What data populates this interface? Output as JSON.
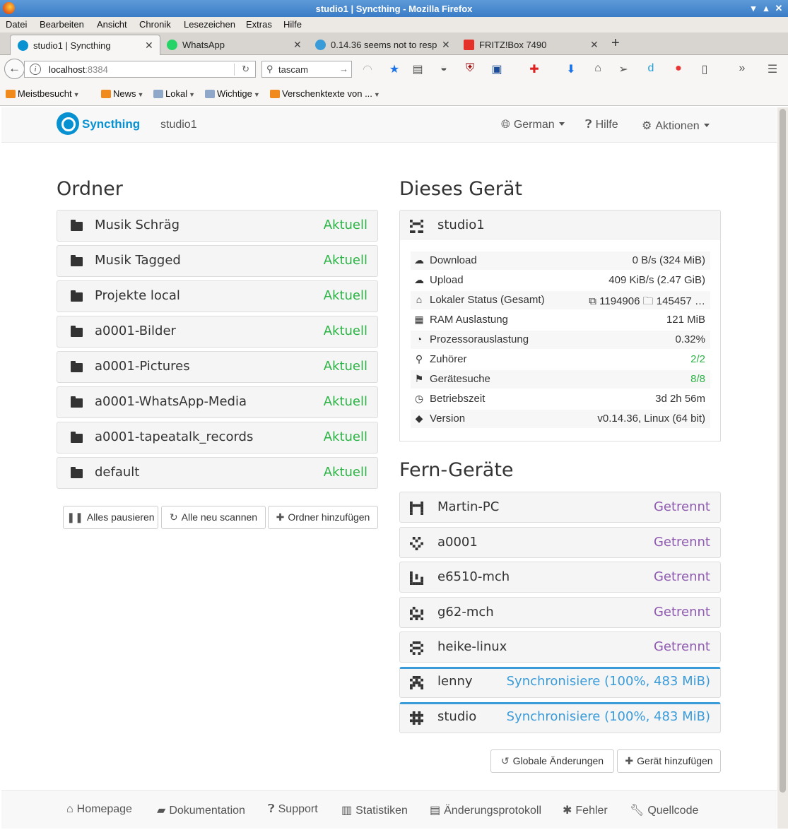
{
  "window": {
    "title": "studio1 | Syncthing - Mozilla Firefox"
  },
  "menu": [
    "Datei",
    "Bearbeiten",
    "Ansicht",
    "Chronik",
    "Lesezeichen",
    "Extras",
    "Hilfe"
  ],
  "tabs": [
    {
      "label": "studio1 | Syncthing"
    },
    {
      "label": "WhatsApp"
    },
    {
      "label": "0.14.36 seems not to resp"
    },
    {
      "label": "FRITZ!Box 7490"
    }
  ],
  "urlbar": {
    "host": "localhost",
    "port": ":8384"
  },
  "search": {
    "value": "tascam"
  },
  "bookmarks": [
    "Meistbesucht",
    "News",
    "Lokal",
    "Wichtige",
    "Verschenktexte von ..."
  ],
  "app": {
    "brand": "Syncthing",
    "device": "studio1",
    "nav": {
      "language": "German",
      "help": "Hilfe",
      "actions": "Aktionen"
    }
  },
  "folders": {
    "heading": "Ordner",
    "items": [
      {
        "name": "Musik Schräg",
        "status": "Aktuell"
      },
      {
        "name": "Musik Tagged",
        "status": "Aktuell"
      },
      {
        "name": "Projekte local",
        "status": "Aktuell"
      },
      {
        "name": "a0001-Bilder",
        "status": "Aktuell"
      },
      {
        "name": "a0001-Pictures",
        "status": "Aktuell"
      },
      {
        "name": "a0001-WhatsApp-Media",
        "status": "Aktuell"
      },
      {
        "name": "a0001-tapeatalk_records",
        "status": "Aktuell"
      },
      {
        "name": "default",
        "status": "Aktuell"
      }
    ],
    "buttons": {
      "pause": "Alles pausieren",
      "rescan": "Alle neu scannen",
      "add": "Ordner hinzufügen"
    }
  },
  "this_device": {
    "heading": "Dieses Gerät",
    "name": "studio1",
    "rows": [
      {
        "label": "Download",
        "value": "0 B/s (324 MiB)",
        "icon": "cloud-download-icon",
        "color": "#333333"
      },
      {
        "label": "Upload",
        "value": "409 KiB/s (2.47 GiB)",
        "icon": "cloud-upload-icon",
        "color": "#333333"
      },
      {
        "label": "Lokaler Status (Gesamt)",
        "value": "⧉ 1194906   🗀 145457   …",
        "icon": "home-icon",
        "color": "#333333"
      },
      {
        "label": "RAM Auslastung",
        "value": "121 MiB",
        "icon": "ram-icon",
        "color": "#333333"
      },
      {
        "label": "Prozessorauslastung",
        "value": "0.32%",
        "icon": "dashboard-icon",
        "color": "#333333"
      },
      {
        "label": "Zuhörer",
        "value": "2/2",
        "icon": "sitemap-icon",
        "color": "#2cb345"
      },
      {
        "label": "Gerätesuche",
        "value": "8/8",
        "icon": "signpost-icon",
        "color": "#2cb345"
      },
      {
        "label": "Betriebszeit",
        "value": "3d 2h 56m",
        "icon": "clock-icon",
        "color": "#333333"
      },
      {
        "label": "Version",
        "value": "v0.14.36, Linux (64 bit)",
        "icon": "tag-icon",
        "color": "#333333"
      }
    ]
  },
  "remote": {
    "heading": "Fern-Geräte",
    "items": [
      {
        "name": "Martin-PC",
        "status": "Getrennt",
        "kind": "disconnected"
      },
      {
        "name": "a0001",
        "status": "Getrennt",
        "kind": "disconnected"
      },
      {
        "name": "e6510-mch",
        "status": "Getrennt",
        "kind": "disconnected"
      },
      {
        "name": "g62-mch",
        "status": "Getrennt",
        "kind": "disconnected"
      },
      {
        "name": "heike-linux",
        "status": "Getrennt",
        "kind": "disconnected"
      },
      {
        "name": "lenny",
        "status": "Synchronisiere (100%, 483 MiB)",
        "kind": "syncing"
      },
      {
        "name": "studio",
        "status": "Synchronisiere (100%, 483 MiB)",
        "kind": "syncing"
      }
    ],
    "buttons": {
      "global": "Globale Änderungen",
      "add": "Gerät hinzufügen"
    }
  },
  "footer": [
    "Homepage",
    "Dokumentation",
    "Support",
    "Statistiken",
    "Änderungsprotokoll",
    "Fehler",
    "Quellcode"
  ],
  "colors": {
    "accent": "#0891d1",
    "ok": "#2cb345",
    "disconnected": "#8f5bb0",
    "syncing": "#3a9bd9"
  }
}
